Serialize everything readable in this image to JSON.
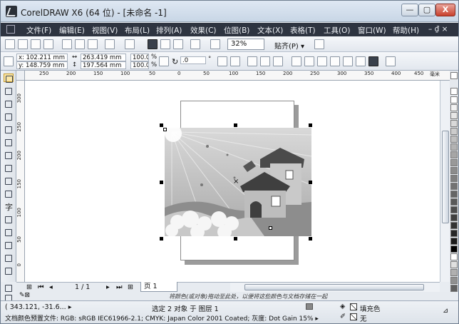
{
  "window": {
    "title": "CorelDRAW X6 (64 位) - [未命名 -1]",
    "min_label": "—",
    "max_label": "▢",
    "close_label": "X"
  },
  "menubar": {
    "items": [
      {
        "label": "文件(F)"
      },
      {
        "label": "编辑(E)"
      },
      {
        "label": "视图(V)"
      },
      {
        "label": "布局(L)"
      },
      {
        "label": "排列(A)"
      },
      {
        "label": "效果(C)"
      },
      {
        "label": "位图(B)"
      },
      {
        "label": "文本(X)"
      },
      {
        "label": "表格(T)"
      },
      {
        "label": "工具(O)"
      },
      {
        "label": "窗口(W)"
      },
      {
        "label": "帮助(H)"
      }
    ],
    "extra": "– ₫ ×"
  },
  "toolbar": {
    "zoom": "32%",
    "snap": "贴齐(P) ▾"
  },
  "propertybar": {
    "x": "x: 102.211 mm",
    "y": "y: 148.759 mm",
    "w": "263.419 mm",
    "h": "197.564 mm",
    "scale_x": "100.0",
    "scale_y": "100.0",
    "pct": "%",
    "angle": ".0",
    "deg": "°"
  },
  "ruler": {
    "h_ticks": [
      "250",
      "200",
      "150",
      "100",
      "50",
      "0",
      "50",
      "100",
      "150",
      "200",
      "250",
      "300",
      "350",
      "400",
      "450"
    ],
    "unit": "毫米",
    "v_ticks": [
      "300",
      "250",
      "200",
      "150",
      "100",
      "50",
      "0"
    ]
  },
  "toolbox": {
    "text_tool_glyph": "字"
  },
  "palette": {
    "colors": [
      "#ffffff",
      "#f2f2f2",
      "#e6e6e6",
      "#d9d9d9",
      "#cccccc",
      "#bfbfbf",
      "#b3b3b3",
      "#a6a6a6",
      "#999999",
      "#8c8c8c",
      "#808080",
      "#737373",
      "#666666",
      "#595959",
      "#4d4d4d",
      "#404040",
      "#333333",
      "#262626",
      "#1a1a1a",
      "#000000",
      "#ffffff",
      "#e0e0e0",
      "#b0b0b0",
      "#909090",
      "#606060"
    ]
  },
  "pagenav": {
    "page_count": "1 / 1",
    "page_tab": "页 1"
  },
  "hint": "将颜色(或对象)拖动至此处，以便将这些颜色与文档存储在一起",
  "status": {
    "coords": "( 343.121, -31.6... ▸",
    "selection": "选定 2 对象 于 图层 1",
    "fill": "填充色",
    "outline": "无",
    "profile": "文档颜色预置文件: RGB: sRGB IEC61966-2.1; CMYK: Japan Color 2001 Coated; 灰度: Dot Gain 15% ▸"
  },
  "colors": {
    "menubar_bg": "#2e3440",
    "canvas_bg": "#ffffff",
    "selected_tool": "#fbe7a8"
  }
}
